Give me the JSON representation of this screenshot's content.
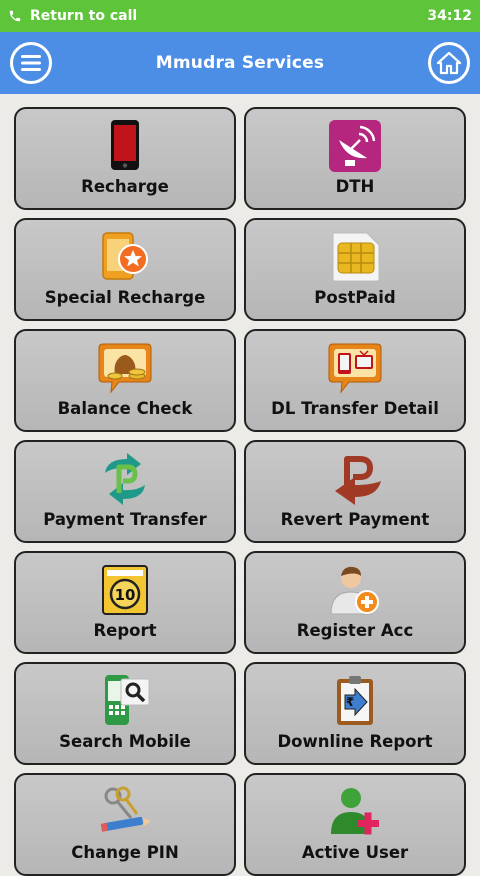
{
  "status_bar": {
    "call_text": "Return to call",
    "time": "34:12"
  },
  "app_bar": {
    "title": "Mmudra Services",
    "menu_icon": "menu-icon",
    "home_icon": "home-icon"
  },
  "colors": {
    "status_bar": "#5ec53a",
    "app_bar": "#4c8ee6",
    "tile": "#c0c0c0"
  },
  "tiles": [
    {
      "label": "Recharge",
      "icon": "mobile-phone-icon"
    },
    {
      "label": "DTH",
      "icon": "satellite-dish-icon"
    },
    {
      "label": "Special Recharge",
      "icon": "special-recharge-icon"
    },
    {
      "label": "PostPaid",
      "icon": "sim-card-icon"
    },
    {
      "label": "Balance Check",
      "icon": "money-bag-icon"
    },
    {
      "label": "DL Transfer Detail",
      "icon": "devices-icon"
    },
    {
      "label": "Payment Transfer",
      "icon": "payment-transfer-icon"
    },
    {
      "label": "Revert Payment",
      "icon": "revert-payment-icon"
    },
    {
      "label": "Report",
      "icon": "report-icon"
    },
    {
      "label": "Register Acc",
      "icon": "add-user-icon"
    },
    {
      "label": "Search Mobile",
      "icon": "search-mobile-icon"
    },
    {
      "label": "Downline Report",
      "icon": "clipboard-rupee-icon"
    },
    {
      "label": "Change PIN",
      "icon": "keys-pencil-icon"
    },
    {
      "label": "Active User",
      "icon": "active-user-icon"
    }
  ]
}
